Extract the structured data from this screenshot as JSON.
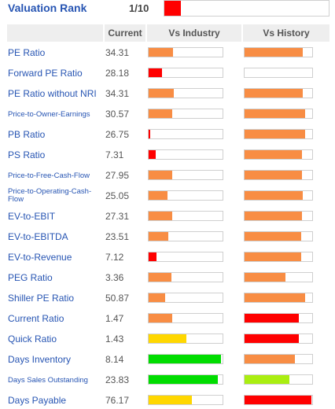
{
  "header": {
    "title": "Valuation Rank",
    "score": "1/10",
    "score_fraction": 0.1,
    "score_color": "#ff0000"
  },
  "columns": {
    "current": "Current",
    "vs_industry": "Vs Industry",
    "vs_history": "Vs History"
  },
  "colors": {
    "orange": "#f88d44",
    "red": "#ff0000",
    "yellow": "#ffd700",
    "green": "#00dd00",
    "lime": "#aaee11"
  },
  "rows": [
    {
      "name": "PE Ratio",
      "size": "normal",
      "value": "34.31",
      "industry": {
        "fraction": 0.33,
        "color": "orange"
      },
      "history": {
        "fraction": 0.86,
        "color": "orange"
      }
    },
    {
      "name": "Forward PE Ratio",
      "size": "normal",
      "value": "28.18",
      "industry": {
        "fraction": 0.18,
        "color": "red"
      },
      "history": {
        "fraction": 0,
        "color": "orange"
      }
    },
    {
      "name": "PE Ratio without NRI",
      "size": "normal",
      "value": "34.31",
      "industry": {
        "fraction": 0.34,
        "color": "orange"
      },
      "history": {
        "fraction": 0.86,
        "color": "orange"
      }
    },
    {
      "name": "Price-to-Owner-Earnings",
      "size": "small",
      "value": "30.57",
      "industry": {
        "fraction": 0.32,
        "color": "orange"
      },
      "history": {
        "fraction": 0.89,
        "color": "orange"
      }
    },
    {
      "name": "PB Ratio",
      "size": "normal",
      "value": "26.75",
      "industry": {
        "fraction": 0.02,
        "color": "red"
      },
      "history": {
        "fraction": 0.89,
        "color": "orange"
      }
    },
    {
      "name": "PS Ratio",
      "size": "normal",
      "value": "7.31",
      "industry": {
        "fraction": 0.1,
        "color": "red"
      },
      "history": {
        "fraction": 0.85,
        "color": "orange"
      }
    },
    {
      "name": "Price-to-Free-Cash-Flow",
      "size": "small",
      "value": "27.95",
      "industry": {
        "fraction": 0.32,
        "color": "orange"
      },
      "history": {
        "fraction": 0.85,
        "color": "orange"
      }
    },
    {
      "name": "Price-to-Operating-Cash-Flow",
      "size": "two-line",
      "value": "25.05",
      "industry": {
        "fraction": 0.26,
        "color": "orange"
      },
      "history": {
        "fraction": 0.86,
        "color": "orange"
      }
    },
    {
      "name": "EV-to-EBIT",
      "size": "normal",
      "value": "27.31",
      "industry": {
        "fraction": 0.32,
        "color": "orange"
      },
      "history": {
        "fraction": 0.85,
        "color": "orange"
      }
    },
    {
      "name": "EV-to-EBITDA",
      "size": "normal",
      "value": "23.51",
      "industry": {
        "fraction": 0.27,
        "color": "orange"
      },
      "history": {
        "fraction": 0.84,
        "color": "orange"
      }
    },
    {
      "name": "EV-to-Revenue",
      "size": "normal",
      "value": "7.12",
      "industry": {
        "fraction": 0.11,
        "color": "red"
      },
      "history": {
        "fraction": 0.84,
        "color": "orange"
      }
    },
    {
      "name": "PEG Ratio",
      "size": "normal",
      "value": "3.36",
      "industry": {
        "fraction": 0.31,
        "color": "orange"
      },
      "history": {
        "fraction": 0.6,
        "color": "orange"
      }
    },
    {
      "name": "Shiller PE Ratio",
      "size": "normal",
      "value": "50.87",
      "industry": {
        "fraction": 0.22,
        "color": "orange"
      },
      "history": {
        "fraction": 0.89,
        "color": "orange"
      }
    },
    {
      "name": "Current Ratio",
      "size": "normal",
      "value": "1.47",
      "industry": {
        "fraction": 0.32,
        "color": "orange"
      },
      "history": {
        "fraction": 0.8,
        "color": "red"
      }
    },
    {
      "name": "Quick Ratio",
      "size": "normal",
      "value": "1.43",
      "industry": {
        "fraction": 0.51,
        "color": "yellow"
      },
      "history": {
        "fraction": 0.8,
        "color": "red"
      }
    },
    {
      "name": "Days Inventory",
      "size": "normal",
      "value": "8.14",
      "industry": {
        "fraction": 0.98,
        "color": "green"
      },
      "history": {
        "fraction": 0.74,
        "color": "orange"
      }
    },
    {
      "name": "Days Sales Outstanding",
      "size": "small",
      "value": "23.83",
      "industry": {
        "fraction": 0.94,
        "color": "green"
      },
      "history": {
        "fraction": 0.66,
        "color": "lime"
      }
    },
    {
      "name": "Days Payable",
      "size": "normal",
      "value": "76.17",
      "industry": {
        "fraction": 0.58,
        "color": "yellow"
      },
      "history": {
        "fraction": 0.99,
        "color": "red"
      }
    }
  ]
}
